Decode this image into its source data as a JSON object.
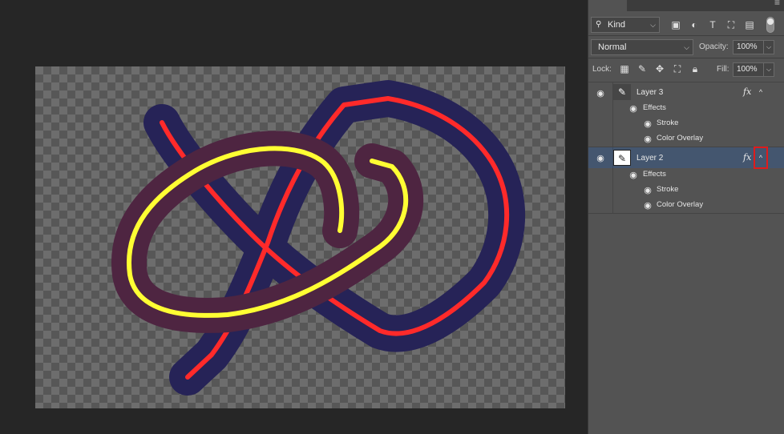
{
  "layers_panel": {
    "filter": {
      "label": "Kind"
    },
    "blend_mode": "Normal",
    "opacity": {
      "label": "Opacity:",
      "value": "100%"
    },
    "lock": {
      "label": "Lock:"
    },
    "fill": {
      "label": "Fill:",
      "value": "100%"
    },
    "layers": [
      {
        "name": "Layer 3",
        "fx": "fx",
        "effects_label": "Effects",
        "effects": [
          "Stroke",
          "Color Overlay"
        ],
        "selected": false
      },
      {
        "name": "Layer 2",
        "fx": "fx",
        "effects_label": "Effects",
        "effects": [
          "Stroke",
          "Color Overlay"
        ],
        "selected": true
      }
    ]
  },
  "icons": {
    "filter": "search-icon",
    "image_filter": "image-icon",
    "adjustment_filter": "half-circle-icon",
    "type_filter": "type-icon",
    "shape_filter": "transform-icon",
    "smart_object_filter": "smart-object-icon",
    "lock_pixels": "checkerboard-icon",
    "lock_image": "brush-icon",
    "lock_position": "move-icon",
    "lock_artboard": "artboard-icon",
    "lock_all": "padlock-icon",
    "visibility": "eye-icon"
  },
  "colors": {
    "panel_bg": "#535353",
    "workspace_bg": "#262626",
    "selected_row": "#44566f",
    "highlight_box": "#e01b1b",
    "stroke_navy": "#262357",
    "stroke_red": "#ff2a2a",
    "stroke_maroon": "#4e2541",
    "stroke_yellow": "#ffff33"
  }
}
